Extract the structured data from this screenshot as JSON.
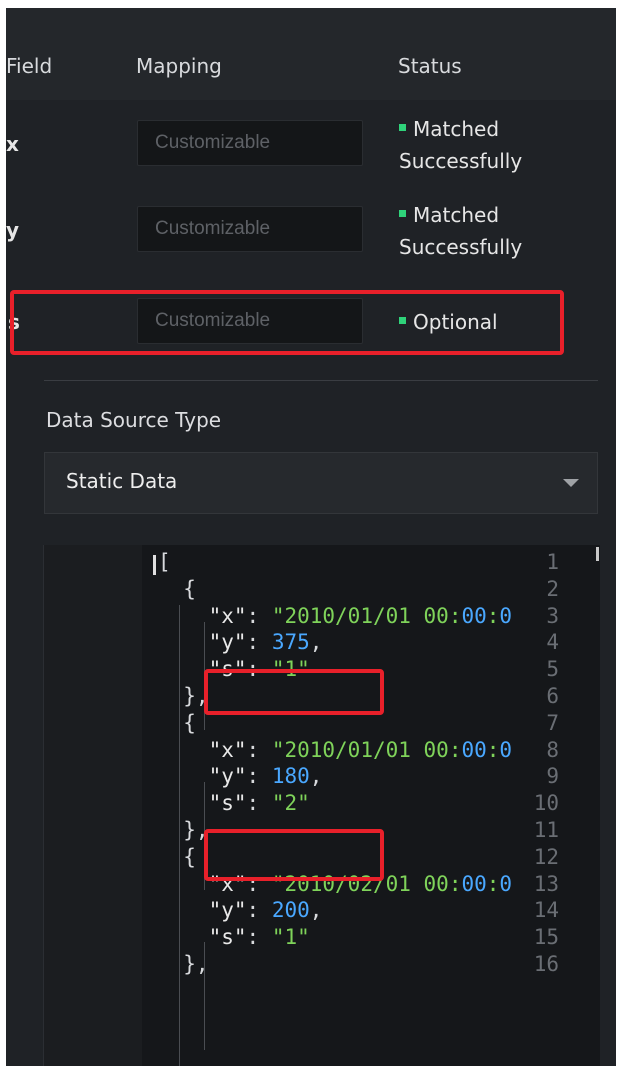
{
  "table": {
    "headers": {
      "field": "Field",
      "mapping": "Mapping",
      "status": "Status"
    },
    "rows": [
      {
        "field": "x",
        "mapping_placeholder": "Customizable",
        "status": "Matched Successfully",
        "status_color": "#2fd37a"
      },
      {
        "field": "y",
        "mapping_placeholder": "Customizable",
        "status": "Matched Successfully",
        "status_color": "#2fd37a"
      },
      {
        "field": "s",
        "mapping_placeholder": "Customizable",
        "status": "Optional",
        "status_color": "#2fd37a"
      }
    ]
  },
  "data_source": {
    "label": "Data Source Type",
    "selected": "Static Data"
  },
  "editor": {
    "line_numbers": [
      "1",
      "2",
      "3",
      "4",
      "5",
      "6",
      "7",
      "8",
      "9",
      "10",
      "11",
      "12",
      "13",
      "14",
      "15",
      "16"
    ],
    "lines": [
      "[",
      "  {",
      "    \"x\": \"2010/01/01 00:00:0",
      "    \"y\": 375,",
      "    \"s\": \"1\"",
      "  },",
      "  {",
      "    \"x\": \"2010/01/01 00:00:0",
      "    \"y\": 180,",
      "    \"s\": \"2\"",
      "  },",
      "  {",
      "    \"x\": \"2010/02/01 00:00:0",
      "    \"y\": 200,",
      "    \"s\": \"1\"",
      "  },"
    ]
  },
  "colors": {
    "highlight": "#e8202a",
    "panel": "#1f2226",
    "string": "#7fd35a",
    "number": "#4aa8ff"
  }
}
